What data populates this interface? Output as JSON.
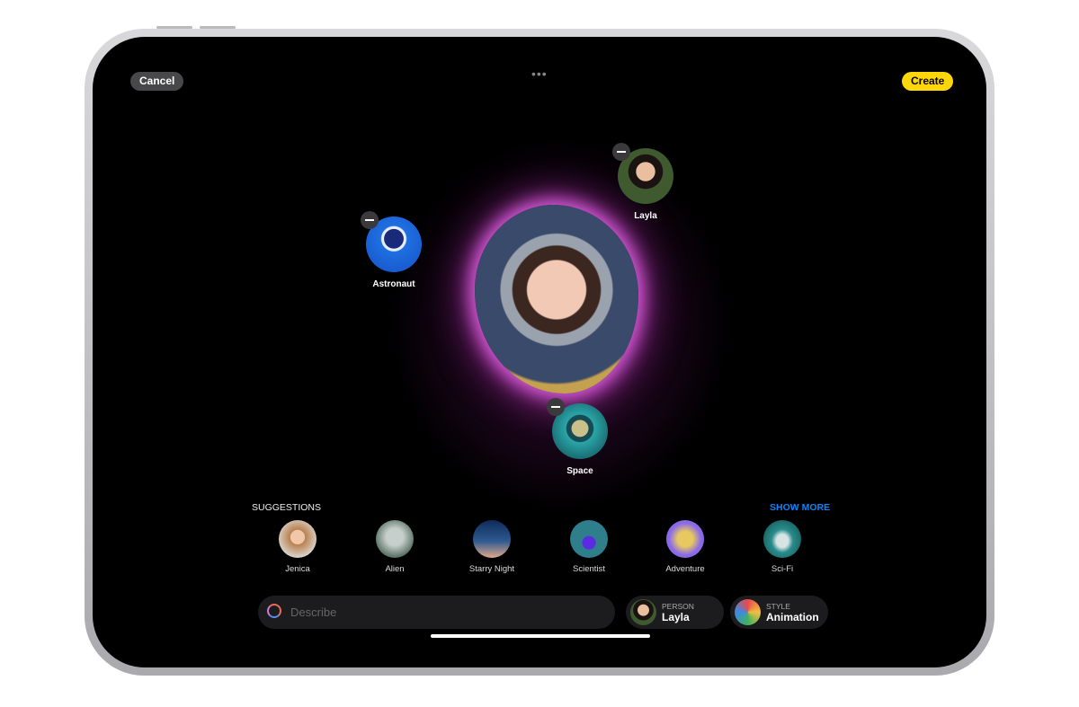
{
  "toolbar": {
    "cancel_label": "Cancel",
    "create_label": "Create",
    "create_color": "#ffd60a"
  },
  "canvas": {
    "concepts": [
      {
        "label": "Astronaut",
        "icon": "astronaut-helmet-icon"
      },
      {
        "label": "Layla",
        "icon": "person-photo"
      },
      {
        "label": "Space",
        "icon": "planet-icon"
      }
    ]
  },
  "suggestions": {
    "title": "SUGGESTIONS",
    "show_more": "SHOW MORE",
    "show_more_color": "#0a84ff",
    "items": [
      {
        "label": "Jenica"
      },
      {
        "label": "Alien"
      },
      {
        "label": "Starry Night"
      },
      {
        "label": "Scientist"
      },
      {
        "label": "Adventure"
      },
      {
        "label": "Sci-Fi"
      }
    ]
  },
  "bottom": {
    "describe_placeholder": "Describe",
    "person": {
      "key": "PERSON",
      "value": "Layla"
    },
    "style": {
      "key": "STYLE",
      "value": "Animation"
    }
  }
}
